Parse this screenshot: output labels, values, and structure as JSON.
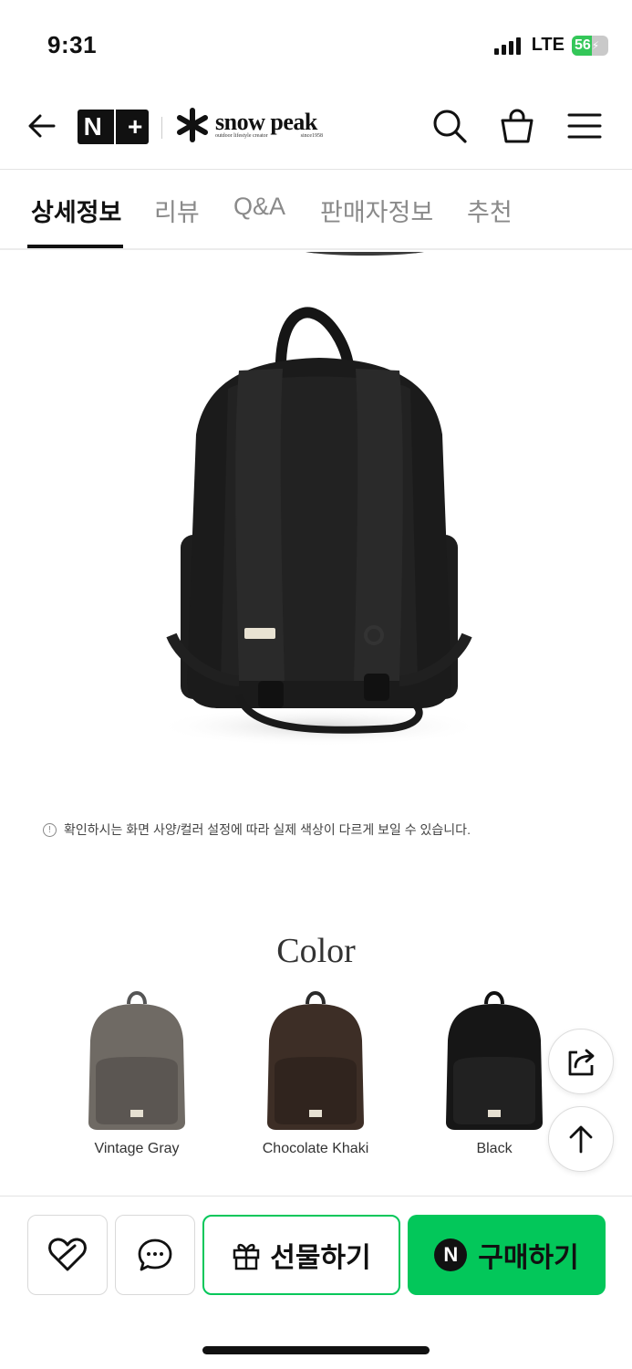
{
  "status_bar": {
    "time": "9:31",
    "network": "LTE",
    "battery_level": "56",
    "battery_fraction": 0.56
  },
  "header": {
    "back_icon": "arrow-left-icon",
    "membership_logo": "N+",
    "brand_name": "snow peak",
    "brand_tagline_left": "outdoor lifestyle creator",
    "brand_tagline_right": "since1958",
    "icons": [
      "search-icon",
      "shopping-bag-icon",
      "menu-icon"
    ]
  },
  "tabs": [
    {
      "label": "상세정보",
      "active": true
    },
    {
      "label": "리뷰",
      "active": false
    },
    {
      "label": "Q&A",
      "active": false
    },
    {
      "label": "판매자정보",
      "active": false
    },
    {
      "label": "추천",
      "active": false
    }
  ],
  "product": {
    "image_description_icon": "backpack-back-view",
    "notice_text": "확인하시는 화면 사양/컬러 설정에 따라 실제 색상이 다르게 보일 수 있습니다."
  },
  "colors_section": {
    "title": "Color",
    "swatches": [
      {
        "label": "Vintage Gray",
        "color": "#6f6a64"
      },
      {
        "label": "Chocolate Khaki",
        "color": "#3d2e26"
      },
      {
        "label": "Black",
        "color": "#161616"
      }
    ]
  },
  "floating": {
    "share_icon": "share-icon",
    "top_icon": "arrow-up-icon"
  },
  "bottom_bar": {
    "wish_icon": "heart-icon",
    "chat_icon": "chat-icon",
    "gift_label": "선물하기",
    "buy_label": "구매하기",
    "buy_badge": "N",
    "accent": "#03c75a"
  }
}
